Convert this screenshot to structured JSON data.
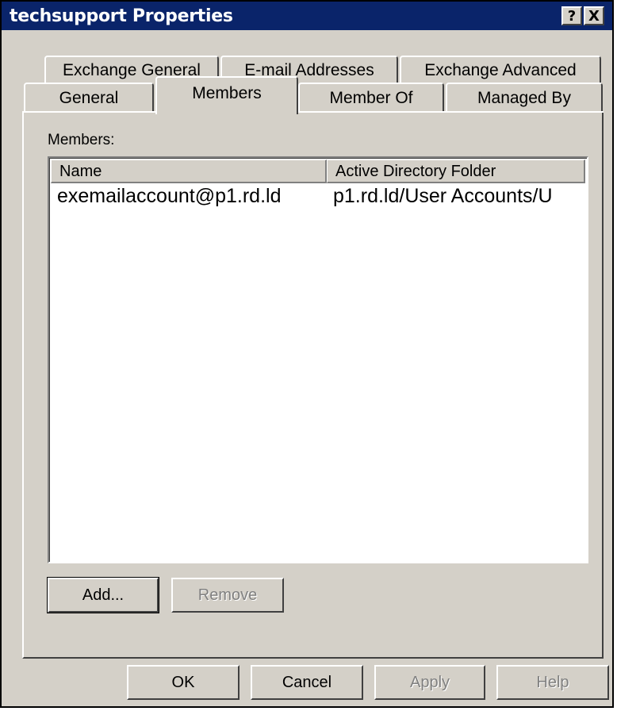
{
  "window": {
    "title": "techsupport Properties",
    "help_glyph": "?",
    "close_glyph": "X"
  },
  "tabs": {
    "row_back": [
      "Exchange General",
      "E-mail Addresses",
      "Exchange Advanced"
    ],
    "row_front": [
      "General",
      "Members",
      "Member Of",
      "Managed By"
    ],
    "selected": "Members"
  },
  "members": {
    "label": "Members:",
    "columns": [
      "Name",
      "Active Directory Folder"
    ],
    "rows": [
      {
        "name": "exemailaccount@p1.rd.ld",
        "folder": "p1.rd.ld/User Accounts/U"
      }
    ],
    "add_label": "Add...",
    "remove_label": "Remove"
  },
  "footer": {
    "ok_label": "OK",
    "cancel_label": "Cancel",
    "apply_label": "Apply",
    "help_label": "Help"
  },
  "colors": {
    "titlebar": "#0a246a",
    "face": "#d4d0c8",
    "disabled_text": "#808080"
  }
}
